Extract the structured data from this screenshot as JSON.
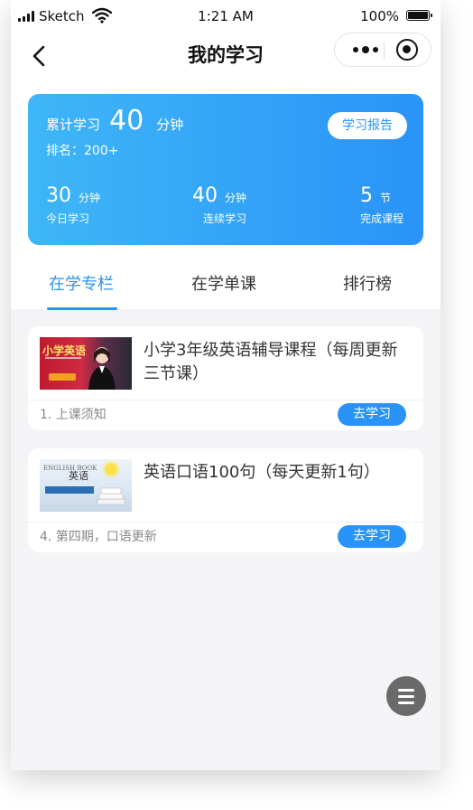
{
  "status_bar": {
    "carrier": "Sketch",
    "time": "1:21 AM",
    "battery": "100%"
  },
  "nav": {
    "title": "我的学习"
  },
  "summary": {
    "total_label": "累计学习",
    "total_value": "40",
    "total_unit": "分钟",
    "rank": "排名：200+",
    "report_button": "学习报告",
    "stats": [
      {
        "value": "30",
        "unit": "分钟",
        "caption": "今日学习"
      },
      {
        "value": "40",
        "unit": "分钟",
        "caption": "连续学习"
      },
      {
        "value": "5",
        "unit": "节",
        "caption": "完成课程"
      }
    ]
  },
  "tabs": [
    {
      "label": "在学专栏",
      "active": true
    },
    {
      "label": "在学单课",
      "active": false
    },
    {
      "label": "排行榜",
      "active": false
    }
  ],
  "courses": [
    {
      "title": "小学3年级英语辅导课程（每周更新三节课）",
      "subtitle": "1. 上课须知",
      "button": "去学习",
      "thumb_text": "小学英语"
    },
    {
      "title": "英语口语100句（每天更新1句）",
      "subtitle": "4. 第四期，口语更新",
      "button": "去学习",
      "thumb_text": "英语",
      "thumb_text_en": "ENGLISH BOOK"
    }
  ],
  "colors": {
    "accent": "#2a93f7",
    "card_gradient_start": "#3fb6f7",
    "card_gradient_end": "#2a93f7",
    "fab": "#6a6a6a"
  }
}
